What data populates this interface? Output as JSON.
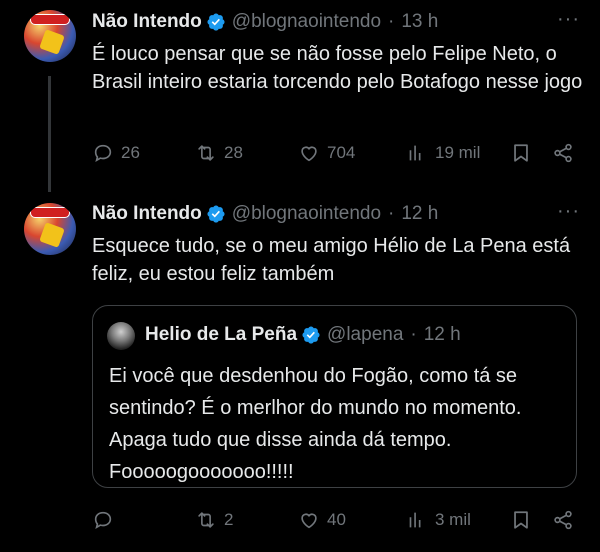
{
  "tweets": [
    {
      "name": "Não Intendo",
      "handle": "@blognaointendo",
      "separator": "·",
      "time": "13 h",
      "more": "···",
      "text": "É louco pensar que se não fosse pelo Felipe Neto, o Brasil inteiro estaria torcendo pelo Botafogo nesse jogo",
      "replies": "26",
      "retweets": "28",
      "likes": "704",
      "views": "19 mil"
    },
    {
      "name": "Não Intendo",
      "handle": "@blognaointendo",
      "separator": "·",
      "time": "12 h",
      "more": "···",
      "text": "Esquece tudo, se o meu amigo Hélio de La Pena está feliz, eu estou feliz também",
      "replies": "",
      "retweets": "2",
      "likes": "40",
      "views": "3 mil",
      "quote": {
        "name": "Helio de La Peña",
        "handle": "@lapena",
        "separator": "·",
        "time": "12 h",
        "text": "Ei você que desdenhou do Fogão, como tá se sentindo? É o merlhor do mundo no momento. Apaga tudo que disse ainda dá tempo. Fooooogooooooo!!!!!"
      }
    }
  ],
  "icons": {
    "reply": "reply-icon",
    "retweet": "retweet-icon",
    "like": "heart-icon",
    "views": "views-icon",
    "bookmark": "bookmark-icon",
    "share": "share-icon",
    "verified": "verified-badge-icon"
  },
  "colors": {
    "background": "#000000",
    "text": "#e7e9ea",
    "muted": "#71767b",
    "verified": "#1d9bf0",
    "border": "#3e4144"
  }
}
